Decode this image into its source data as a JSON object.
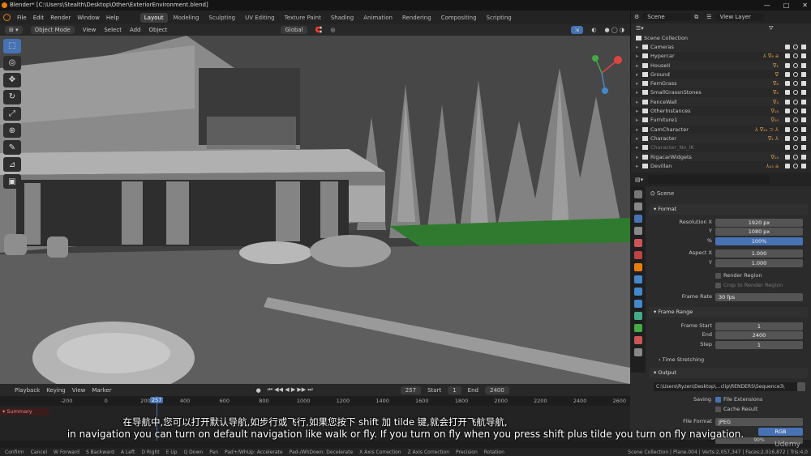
{
  "titlebar": {
    "title": "Blender* [C:\\Users\\Stealth\\Desktop\\Other\\ExteriorEnvironment.blend]",
    "min": "—",
    "max": "□",
    "close": "✕"
  },
  "menu": [
    "File",
    "Edit",
    "Render",
    "Window",
    "Help"
  ],
  "workspaces": [
    {
      "label": "Layout",
      "active": true
    },
    {
      "label": "Modeling",
      "active": false
    },
    {
      "label": "Sculpting",
      "active": false
    },
    {
      "label": "UV Editing",
      "active": false
    },
    {
      "label": "Texture Paint",
      "active": false
    },
    {
      "label": "Shading",
      "active": false
    },
    {
      "label": "Animation",
      "active": false
    },
    {
      "label": "Rendering",
      "active": false
    },
    {
      "label": "Compositing",
      "active": false
    },
    {
      "label": "Scripting",
      "active": false
    }
  ],
  "scene_selector": "Scene",
  "view_layer": "View Layer",
  "viewport_header": {
    "mode": "Object Mode",
    "items": [
      "View",
      "Select",
      "Add",
      "Object"
    ],
    "transform": "Global"
  },
  "tools": [
    "select-tool",
    "cursor-tool",
    "move-tool",
    "rotate-tool",
    "scale-tool",
    "transform-tool",
    "annotate-tool",
    "measure-tool",
    "add-cube-tool"
  ],
  "tool_glyphs": [
    "⬚",
    "◎",
    "✥",
    "↻",
    "⤢",
    "⊕",
    "✎",
    "⊿",
    "▣"
  ],
  "outliner": {
    "collection_label": "Scene Collection",
    "rows": [
      {
        "label": "Cameras",
        "mods": "",
        "dim": false
      },
      {
        "label": "Hypercar",
        "mods": "⅄ ∇₆ a",
        "dim": false
      },
      {
        "label": "HouseII",
        "mods": "∇₁",
        "dim": false
      },
      {
        "label": "Ground",
        "mods": "∇",
        "dim": false
      },
      {
        "label": "FernGrass",
        "mods": "∇₈",
        "dim": false
      },
      {
        "label": "SmallGrassnStones",
        "mods": "∇₂",
        "dim": false
      },
      {
        "label": "FenceWall",
        "mods": "∇₃",
        "dim": false
      },
      {
        "label": "OtherInstances",
        "mods": "∇₁₈",
        "dim": false
      },
      {
        "label": "Furniture1",
        "mods": "∇₁₀",
        "dim": false
      },
      {
        "label": "CamCharacter",
        "mods": "⅄ ∇₂₁ ⊃ ⅄",
        "dim": false
      },
      {
        "label": "Character",
        "mods": "∇₁ ⅄",
        "dim": false
      },
      {
        "label": "Character_No_IK",
        "mods": "",
        "dim": true
      },
      {
        "label": "RigacarWidgets",
        "mods": "∇₁₄",
        "dim": false
      },
      {
        "label": "Devillan",
        "mods": "⅄₂₅ a",
        "dim": false
      }
    ]
  },
  "properties": {
    "breadcrumb": "Scene",
    "format_label": "Format",
    "resolution_x_label": "Resolution X",
    "resolution_x": "1920 px",
    "resolution_y_label": "Y",
    "resolution_y": "1080 px",
    "percent_label": "%",
    "percent": "100%",
    "aspect_x_label": "Aspect X",
    "aspect_x": "1.000",
    "aspect_y_label": "Y",
    "aspect_y": "1.000",
    "render_region": "Render Region",
    "crop_region": "Crop to Render Region",
    "frame_rate_label": "Frame Rate",
    "frame_rate": "30 fps",
    "frame_range_label": "Frame Range",
    "frame_start_label": "Frame Start",
    "frame_start": "1",
    "frame_end_label": "End",
    "frame_end": "2400",
    "step_label": "Step",
    "step": "1",
    "time_stretching": "Time Stretching",
    "output_label": "Output",
    "output_path": "C:\\Users\\Ryzen\\Desktop\\...clip\\RENDERS\\Sequence3\\",
    "saving_label": "Saving",
    "file_extensions": "File Extensions",
    "cache_result": "Cache Result",
    "file_format_label": "File Format",
    "file_format": "JPEG",
    "color_mode": "RGB",
    "quality": "90%"
  },
  "timeline": {
    "menu": [
      "Playback",
      "Keying",
      "View",
      "Marker"
    ],
    "current_frame": "257",
    "start_label": "Start",
    "start": "1",
    "end_label": "End",
    "end": "2400",
    "ticks": [
      "-200",
      "0",
      "200",
      "400",
      "600",
      "800",
      "1000",
      "1200",
      "1400",
      "1600",
      "1800",
      "2000",
      "2200",
      "2400",
      "2600"
    ],
    "playhead_label": "257",
    "summary": "Summary"
  },
  "status": [
    "Confirm",
    "Cancel",
    "W Forward",
    "S Backward",
    "A Left",
    "D Right",
    "E Up",
    "Q Down",
    "Pan",
    "Pad+/WhUp: Accelerate",
    "Pad-/WhDown: Decelerate",
    "X Axis Correction",
    "Z Axis Correction",
    "Precision",
    "Rotation"
  ],
  "status_right": "Scene Collection | Plane.004 | Verts:2,057,347 | Faces:2,016,872 | Tris:4,0",
  "subtitle_cn": "在导航中,您可以打开默认导航,如步行或飞行,如果您按下 shift 加 tilde 键,就会打开飞航导航,",
  "subtitle_en": "in navigation you can turn on default navigation like walk or fly. If you turn on fly when you press shift plus tilde you turn on fly navigation.",
  "watermark": "Udemy",
  "colors": {
    "accent": "#4772b3",
    "orange": "#e87d0d",
    "grass": "#2f7a2f"
  }
}
